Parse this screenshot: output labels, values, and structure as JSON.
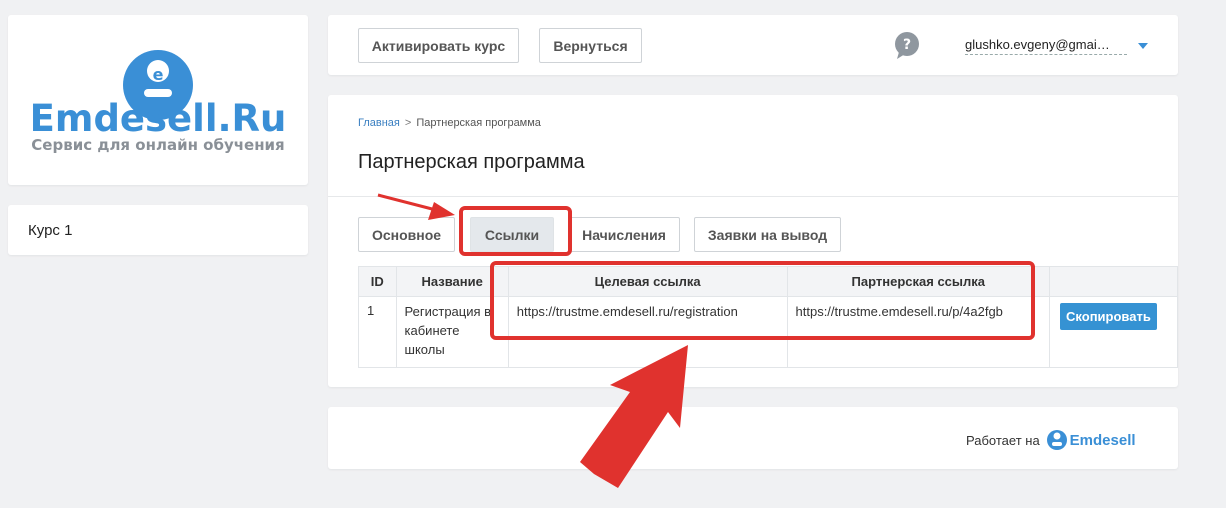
{
  "logo": {
    "brand": "Emdesell.Ru",
    "tagline": "Сервис для онлайн обучения",
    "letter": "e"
  },
  "sidebar": {
    "courses": [
      {
        "label": "Курс 1"
      }
    ]
  },
  "header": {
    "activate_label": "Активировать курс",
    "back_label": "Вернуться",
    "help_icon": "question-bubble-icon",
    "user_email": "glushko.evgeny@gmai…"
  },
  "breadcrumb": {
    "home": "Главная",
    "separator": ">",
    "current": "Партнерская программа"
  },
  "page_title": "Партнерская программа",
  "tabs": [
    {
      "label": "Основное",
      "active": false
    },
    {
      "label": "Ссылки",
      "active": true
    },
    {
      "label": "Начисления",
      "active": false
    },
    {
      "label": "Заявки на вывод",
      "active": false
    }
  ],
  "table": {
    "columns": [
      "ID",
      "Название",
      "Целевая ссылка",
      "Партнерская ссылка",
      ""
    ],
    "rows": [
      {
        "id": "1",
        "name": "Регистрация в кабинете школы",
        "target": "https://trustme.emdesell.ru/registration",
        "partner": "https://trustme.emdesell.ru/p/4a2fgb",
        "action": "Скопировать"
      }
    ]
  },
  "footer": {
    "powered_label": "Работает на",
    "brand": "Emdesell",
    "letter": "e"
  },
  "colors": {
    "accent": "#3592d3",
    "annotation": "#e0322e"
  }
}
